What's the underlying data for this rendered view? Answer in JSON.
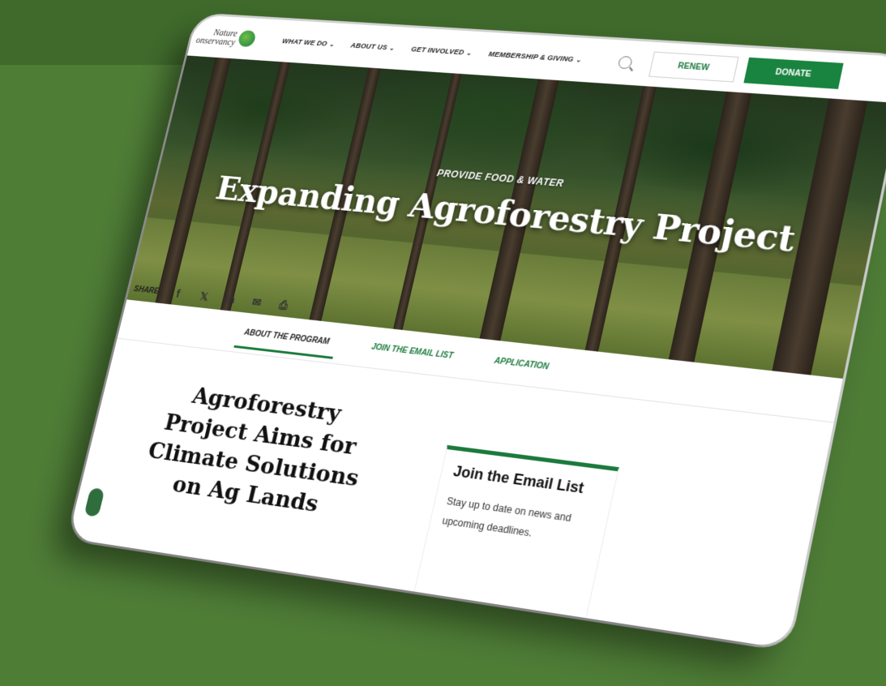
{
  "site": {
    "logo_line1": "Nature",
    "logo_line2": "onservancy"
  },
  "nav": {
    "links": [
      {
        "label": "WHAT WE DO"
      },
      {
        "label": "ABOUT US"
      },
      {
        "label": "GET INVOLVED"
      },
      {
        "label": "MEMBERSHIP & GIVING"
      }
    ],
    "renew_label": "RENEW",
    "donate_label": "DONATE"
  },
  "hero": {
    "eyebrow": "PROVIDE FOOD & WATER",
    "title": "Expanding Agroforestry Project"
  },
  "share": {
    "label": "SHARE",
    "icons": [
      "facebook-icon",
      "x-icon",
      "linkedin-icon",
      "email-icon",
      "print-icon"
    ],
    "glyphs": {
      "facebook": "f",
      "x": "𝕏",
      "linkedin": "in",
      "email": "✉",
      "print": "⎙"
    }
  },
  "tabs": [
    {
      "label": "ABOUT THE PROGRAM",
      "active": true
    },
    {
      "label": "JOIN THE EMAIL LIST",
      "active": false
    },
    {
      "label": "APPLICATION",
      "active": false
    }
  ],
  "main": {
    "heading": "Agroforestry Project Aims for Climate Solutions on Ag Lands"
  },
  "signup": {
    "title": "Join the Email List",
    "text": "Stay up to date on news and upcoming deadlines."
  },
  "colors": {
    "brand_green": "#1a7a3c",
    "donate_green": "#18843f",
    "background_green": "#4e7d36"
  }
}
